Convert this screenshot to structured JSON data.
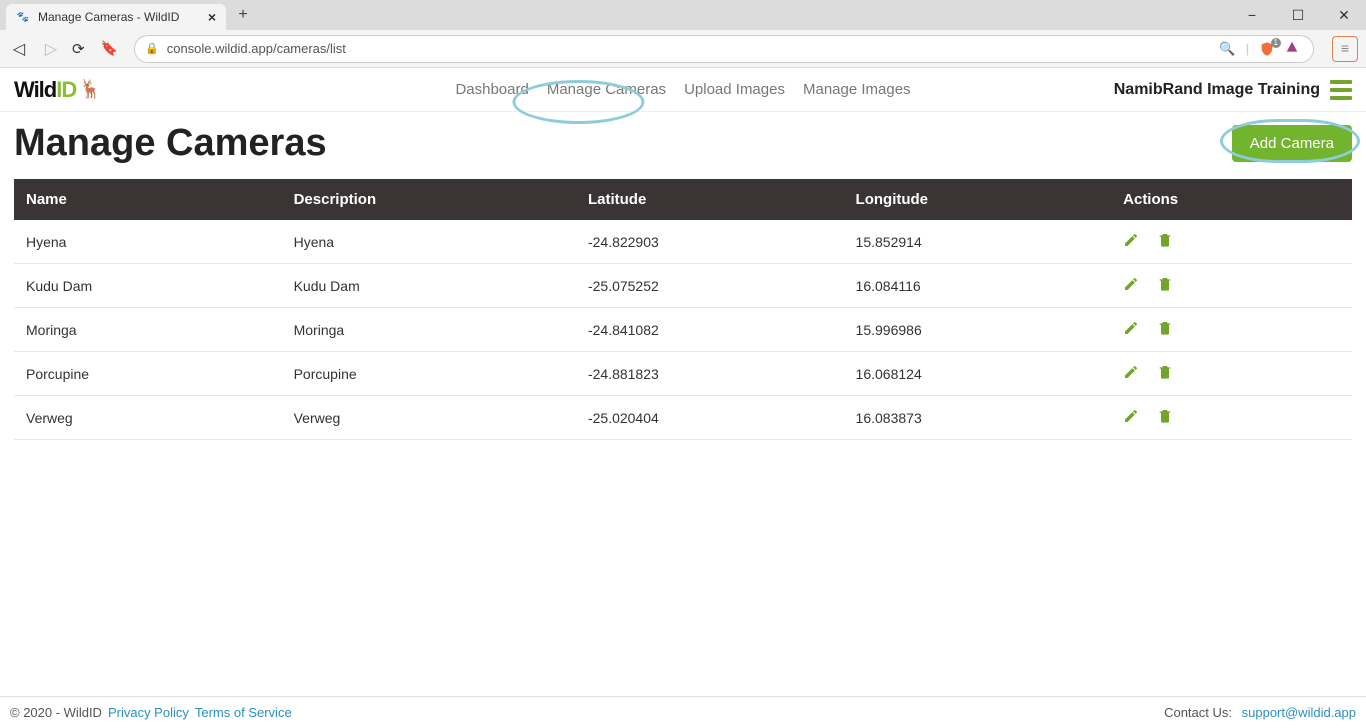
{
  "browser": {
    "tab_title": "Manage Cameras - WildID",
    "url": "console.wildid.app/cameras/list",
    "shield_count": "1"
  },
  "header": {
    "logo_part1": "Wild",
    "logo_part2": "ID",
    "nav": {
      "dashboard": "Dashboard",
      "manage_cameras": "Manage Cameras",
      "upload_images": "Upload Images",
      "manage_images": "Manage Images"
    },
    "project_name": "NamibRand Image Training"
  },
  "page": {
    "title": "Manage Cameras",
    "add_button": "Add Camera"
  },
  "table": {
    "columns": {
      "name": "Name",
      "description": "Description",
      "latitude": "Latitude",
      "longitude": "Longitude",
      "actions": "Actions"
    },
    "rows": [
      {
        "name": "Hyena",
        "description": "Hyena",
        "latitude": "-24.822903",
        "longitude": "15.852914"
      },
      {
        "name": "Kudu Dam",
        "description": "Kudu Dam",
        "latitude": "-25.075252",
        "longitude": "16.084116"
      },
      {
        "name": "Moringa",
        "description": "Moringa",
        "latitude": "-24.841082",
        "longitude": "15.996986"
      },
      {
        "name": "Porcupine",
        "description": "Porcupine",
        "latitude": "-24.881823",
        "longitude": "16.068124"
      },
      {
        "name": "Verweg",
        "description": "Verweg",
        "latitude": "-25.020404",
        "longitude": "16.083873"
      }
    ]
  },
  "footer": {
    "copyright": "© 2020 - WildID",
    "privacy": "Privacy Policy",
    "terms": "Terms of Service",
    "contact_label": "Contact Us:",
    "contact_email": "support@wildid.app"
  }
}
